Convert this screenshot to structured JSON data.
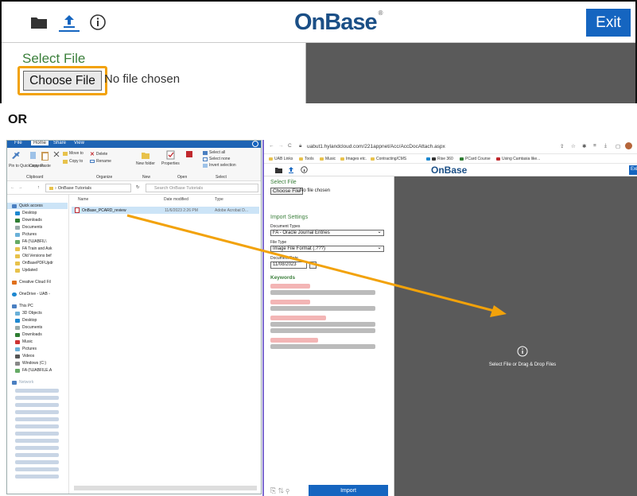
{
  "top": {
    "logo": "OnBase",
    "exit_label": "Exit",
    "select_file_title": "Select File",
    "choose_file_label": "Choose File",
    "no_file_text": "No file chosen"
  },
  "separator": "OR",
  "explorer": {
    "tabs": [
      "File",
      "Home",
      "Share",
      "View"
    ],
    "ribbon": {
      "pin_quick": "Pin to Quick access",
      "copy": "Copy",
      "paste": "Paste",
      "move_to": "Move to",
      "copy_to": "Copy to",
      "delete": "Delete",
      "rename": "Rename",
      "new_folder": "New folder",
      "properties": "Properties",
      "select_all": "Select all",
      "select_none": "Select none",
      "invert_selection": "Invert selection",
      "groups": [
        "Clipboard",
        "Organize",
        "New",
        "Open",
        "Select"
      ]
    },
    "breadcrumb": "OnBase Tutorials",
    "search_placeholder": "Search OnBase Tutorials",
    "nav": [
      "Quick access",
      "Desktop",
      "Downloads",
      "Documents",
      "Pictures",
      "FA (\\\\UABFIL\\",
      "FA Train and Ask",
      "Old Versions bef",
      "OnBasePDFUpdr",
      "Updated",
      "Creative Cloud Fil",
      "OneDrive - UAB -",
      "This PC",
      "3D Objects",
      "Desktop",
      "Documents",
      "Downloads",
      "Music",
      "Pictures",
      "Videos",
      "Windows (C:)",
      "FA (\\\\UABFILE.A",
      "Network"
    ],
    "columns": [
      "Name",
      "Date modified",
      "Type"
    ],
    "file": {
      "name": "OnBase_PCARD_review",
      "date": "11/6/2023 2:26 PM",
      "type": "Adobe Acrobat D..."
    }
  },
  "browser": {
    "url": "uabut1.hylandcloud.com/221appnet/Acc/AccDocAttach.aspx",
    "bookmarks": [
      "UAB Links",
      "Tools",
      "Music",
      "Images etc.",
      "Contracting/CMS",
      "Rise 360",
      "PCard Course",
      "Using Camtasia like..."
    ],
    "logo": "OnBase",
    "exit_label": "Exi",
    "select_file_title": "Select File",
    "choose_file_label": "Choose File",
    "no_file_text": "No file chosen",
    "import_settings": "Import Settings",
    "document_types_label": "Document Types",
    "document_type_value": "FA - Oracle Journal Entries",
    "file_type_label": "File Type",
    "file_type_value": "Image File Format (.???)",
    "document_date_label": "Document Date",
    "document_date_value": "11/08/2023",
    "keywords_label": "Keywords",
    "drop_text": "Select File or Drag & Drop Files",
    "import_label": "Import"
  },
  "colors": {
    "accent": "#1565c0",
    "highlight": "#f2a20a",
    "green_title": "#3b7f3b",
    "dark_panel": "#5a5a5a"
  }
}
